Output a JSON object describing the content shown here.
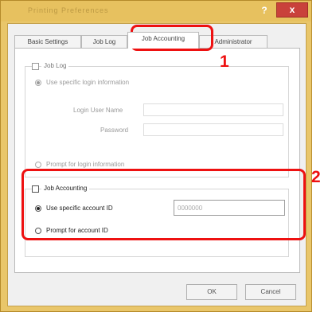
{
  "window": {
    "title": "Printing Preferences",
    "help_glyph": "?",
    "close_glyph": "x"
  },
  "tabs": [
    {
      "label": "Basic Settings"
    },
    {
      "label": "Job Log"
    },
    {
      "label": "Job Accounting"
    },
    {
      "label": "Administrator"
    }
  ],
  "accounting": {
    "group_label": "Job Log",
    "option_use_specific": "Use specific login information",
    "user_name_label": "Login User Name",
    "password_label": "Password",
    "option_prompt": "Prompt for login information"
  },
  "job_accounting": {
    "checkbox_label": "Job Accounting",
    "option_use_specific_id": "Use specific account ID",
    "account_id_value": "0000000",
    "option_prompt_id": "Prompt for account ID"
  },
  "buttons": {
    "ok": "OK",
    "cancel": "Cancel"
  },
  "annotations": {
    "callout_1": "1",
    "callout_2": "2",
    "highlight_color": "#ee1111"
  }
}
